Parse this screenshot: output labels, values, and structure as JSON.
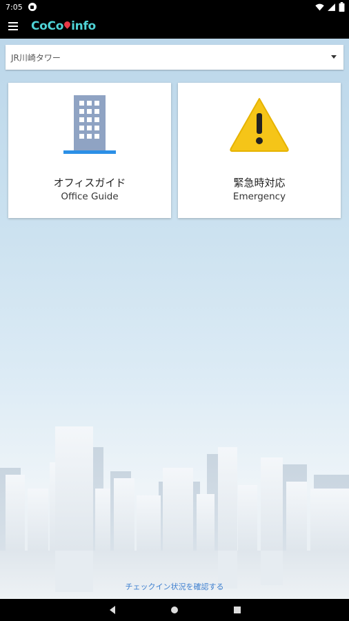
{
  "status_bar": {
    "time": "7:05",
    "app_icon": "notification-app-icon",
    "icons": [
      "wifi-icon",
      "signal-icon",
      "battery-icon"
    ]
  },
  "app_bar": {
    "menu_icon": "hamburger-menu-icon",
    "logo_text_1": "CoCo",
    "logo_text_2": "info",
    "logo_pin_color": "#e63946",
    "logo_color": "#4fd3d6"
  },
  "building_select": {
    "selected": "JR川崎タワー"
  },
  "cards": {
    "office": {
      "title": "オフィスガイド",
      "subtitle": "Office Guide",
      "icon": "office-building-icon"
    },
    "emergency": {
      "title": "緊急時対応",
      "subtitle": "Emergency",
      "icon": "warning-icon"
    }
  },
  "footer": {
    "checkin_link": "チェックイン状況を確認する",
    "link_color": "#3d7fcf"
  },
  "nav_bar": {
    "icons": [
      "back-icon",
      "home-icon",
      "recents-icon"
    ]
  }
}
